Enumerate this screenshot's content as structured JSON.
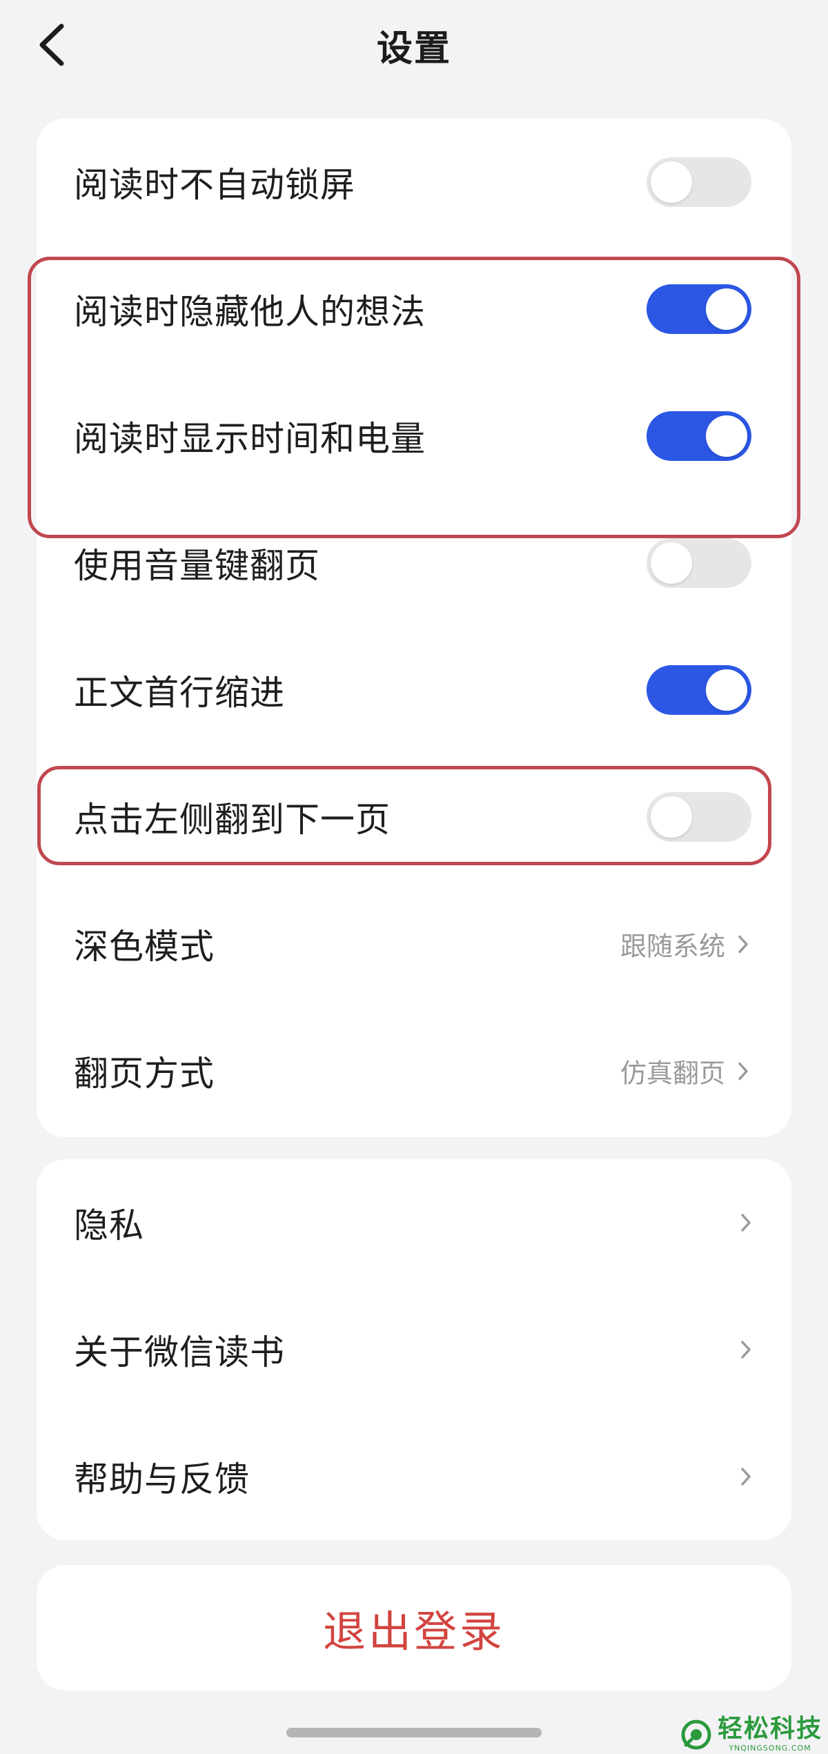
{
  "nav": {
    "title": "设置",
    "back_icon": "chevron-left-icon"
  },
  "settings": {
    "toggles": [
      {
        "label": "阅读时不自动锁屏",
        "on": false
      },
      {
        "label": "阅读时隐藏他人的想法",
        "on": true
      },
      {
        "label": "阅读时显示时间和电量",
        "on": true
      },
      {
        "label": "使用音量键翻页",
        "on": false
      },
      {
        "label": "正文首行缩进",
        "on": true
      },
      {
        "label": "点击左侧翻到下一页",
        "on": false
      }
    ],
    "selects": [
      {
        "label": "深色模式",
        "value": "跟随系统"
      },
      {
        "label": "翻页方式",
        "value": "仿真翻页"
      }
    ]
  },
  "links": [
    {
      "label": "隐私"
    },
    {
      "label": "关于微信读书"
    },
    {
      "label": "帮助与反馈"
    }
  ],
  "logout": {
    "label": "退出登录"
  },
  "watermark": {
    "title": "轻松科技",
    "subtitle": "YNQINGSONG.COM"
  },
  "colors": {
    "toggle_on": "#2b57e4",
    "toggle_off": "#e6e6e8",
    "logout_red": "#d2443f",
    "highlight_border": "#c1474f",
    "background": "#f3f3f5"
  }
}
